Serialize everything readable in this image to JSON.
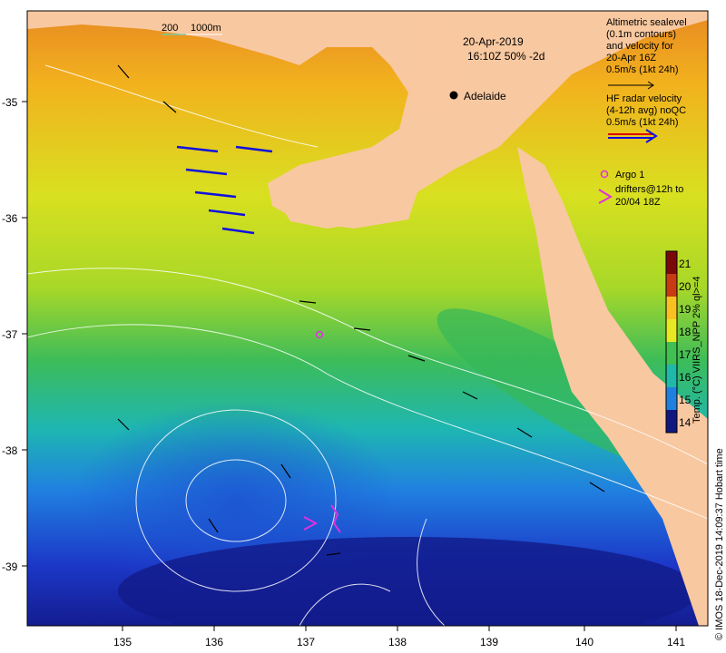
{
  "header": {
    "date": "20-Apr-2019",
    "time_line": "16:10Z  50% -2d"
  },
  "scale_bar": {
    "label_200": "200",
    "label_1000": "1000m"
  },
  "legend": {
    "altimetry_lines": [
      "Altimetric sealevel",
      "(0.1m contours)",
      "and velocity for",
      "20-Apr 16Z",
      "0.5m/s (1kt 24h)"
    ],
    "hf_lines": [
      "HF radar velocity",
      "(4-12h avg) noQC",
      "0.5m/s (1kt 24h)"
    ],
    "argo_label": "Argo 1",
    "drifter_lines": [
      "drifters@12h to",
      "20/04 18Z"
    ]
  },
  "places": {
    "city": "Adelaide"
  },
  "colorbar": {
    "title": "Temp. (°C) VIIRS_NPP 2% ql>=4",
    "ticks": [
      "21",
      "20",
      "19",
      "18",
      "17",
      "16",
      "15",
      "14"
    ],
    "colors": [
      "#7a0a0a",
      "#c83a12",
      "#f0801e",
      "#f8c020",
      "#e8e822",
      "#a8dc22",
      "#40c050",
      "#20b8a8",
      "#2080e0",
      "#1c30c0",
      "#101880"
    ]
  },
  "axes": {
    "lon_ticks": [
      "135",
      "136",
      "137",
      "138",
      "139",
      "140",
      "141"
    ],
    "lat_ticks": [
      "-35",
      "-36",
      "-37",
      "-38",
      "-39"
    ]
  },
  "credit": "© IMOS 18-Dec-2019 14:09:37 Hobart time",
  "colors": {
    "land": "#f8c8a0",
    "argo": "#e030e0",
    "hf_arrow_red": "#e00000",
    "hf_arrow_blue": "#1010e0",
    "contour": "#ffffff"
  }
}
